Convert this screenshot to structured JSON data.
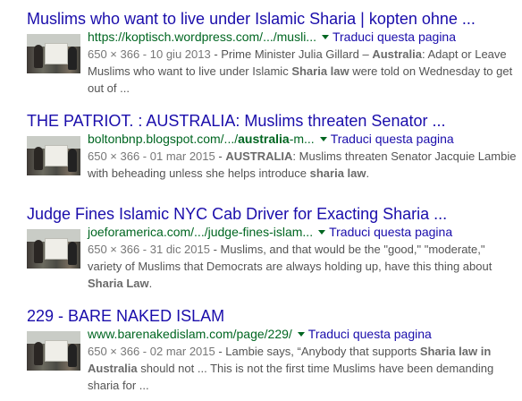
{
  "results": [
    {
      "title": "Muslims who want to live under Islamic Sharia | kopten ohne ...",
      "url": "https://koptisch.wordpress.com/.../musli...",
      "url_bold": "",
      "url_suffix": "",
      "translate": "Traduci questa pagina",
      "meta": "650 × 366 - 10 giu 2013",
      "snippet": [
        {
          "t": " - Prime Minister Julia Gillard – ",
          "b": false
        },
        {
          "t": "Australia",
          "b": true
        },
        {
          "t": ": Adapt or Leave Muslims who want to live under Islamic ",
          "b": false
        },
        {
          "t": "Sharia law",
          "b": true
        },
        {
          "t": " were told on Wednesday to get out of ...",
          "b": false
        }
      ]
    },
    {
      "title": "THE PATRIOT. : AUSTRALIA: Muslims threaten Senator ...",
      "url": "boltonbnp.blogspot.com/.../",
      "url_bold": "australia",
      "url_suffix": "-m...",
      "translate": "Traduci questa pagina",
      "meta": "650 × 366 - 01 mar 2015",
      "snippet": [
        {
          "t": " - ",
          "b": false
        },
        {
          "t": "AUSTRALIA",
          "b": true
        },
        {
          "t": ": Muslims threaten Senator Jacquie Lambie with beheading unless she helps introduce ",
          "b": false
        },
        {
          "t": "sharia law",
          "b": true
        },
        {
          "t": ".",
          "b": false
        }
      ]
    },
    {
      "title": "Judge Fines Islamic NYC Cab Driver for Exacting Sharia ...",
      "url": "joeforamerica.com/.../judge-fines-islam...",
      "url_bold": "",
      "url_suffix": "",
      "translate": "Traduci questa pagina",
      "meta": "650 × 366 - 31 dic 2015",
      "snippet": [
        {
          "t": " - Muslims, and that would be the \"good,\" \"moderate,\" variety of Muslims that Democrats are always holding up, have this thing about ",
          "b": false
        },
        {
          "t": "Sharia Law",
          "b": true
        },
        {
          "t": ".",
          "b": false
        }
      ]
    },
    {
      "title": "229 - BARE NAKED ISLAM",
      "url": "www.barenakedislam.com/page/229/",
      "url_bold": "",
      "url_suffix": "",
      "translate": "Traduci questa pagina",
      "meta": "650 × 366 - 02 mar 2015",
      "snippet": [
        {
          "t": " - Lambie says, “Anybody that supports ",
          "b": false
        },
        {
          "t": "Sharia law in Australia",
          "b": true
        },
        {
          "t": " should not ... This is not the first time Muslims have been demanding sharia for ...",
          "b": false
        }
      ]
    }
  ]
}
